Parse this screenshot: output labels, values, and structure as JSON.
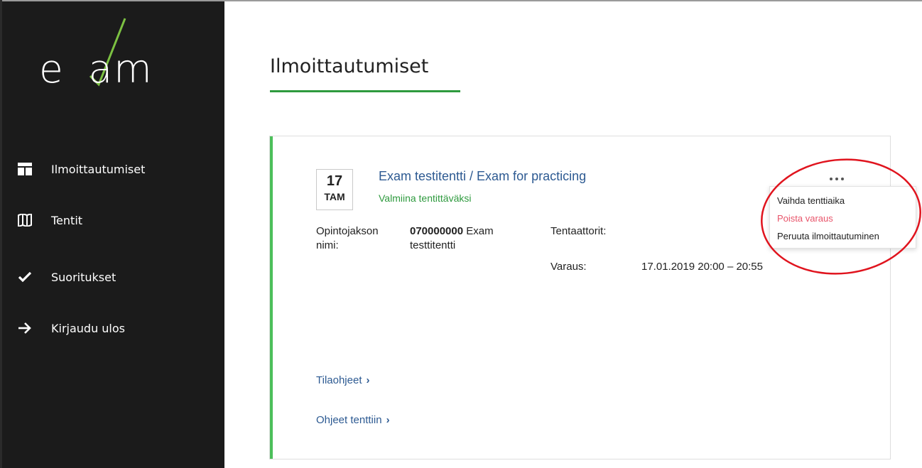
{
  "sidebar": {
    "logo_text": "exam",
    "items": [
      {
        "label": "Ilmoittautumiset",
        "icon": "dashboard-icon"
      },
      {
        "label": "Tentit",
        "icon": "book-icon"
      },
      {
        "label": "Suoritukset",
        "icon": "checkmark-icon"
      },
      {
        "label": "Kirjaudu ulos",
        "icon": "arrow-right-icon"
      }
    ]
  },
  "main": {
    "title": "Ilmoittautumiset",
    "card": {
      "date_day": "17",
      "date_month": "TAM",
      "exam_title": "Exam testitentti / Exam for practicing",
      "status": "Valmiina tentittäväksi",
      "course_label": "Opintojakson nimi:",
      "course_code": "070000000",
      "course_name": "Exam testtitentti",
      "examiners_label": "Tentaattorit:",
      "reservation_label": "Varaus:",
      "reservation_value": "17.01.2019 20:00 – 20:55",
      "links": [
        {
          "label": "Tilaohjeet"
        },
        {
          "label": "Ohjeet tenttiin"
        }
      ],
      "menu": [
        {
          "label": "Vaihda tenttiaika"
        },
        {
          "label": "Poista varaus"
        },
        {
          "label": "Peruuta ilmoittautuminen"
        }
      ]
    }
  },
  "colors": {
    "sidebar_bg": "#1b1b1b",
    "accent_green": "#2e9a3e",
    "card_accent": "#4cbf5a",
    "link_blue": "#2d5a92",
    "danger_pink": "#e8546a",
    "annotation_red": "#e0141e"
  }
}
